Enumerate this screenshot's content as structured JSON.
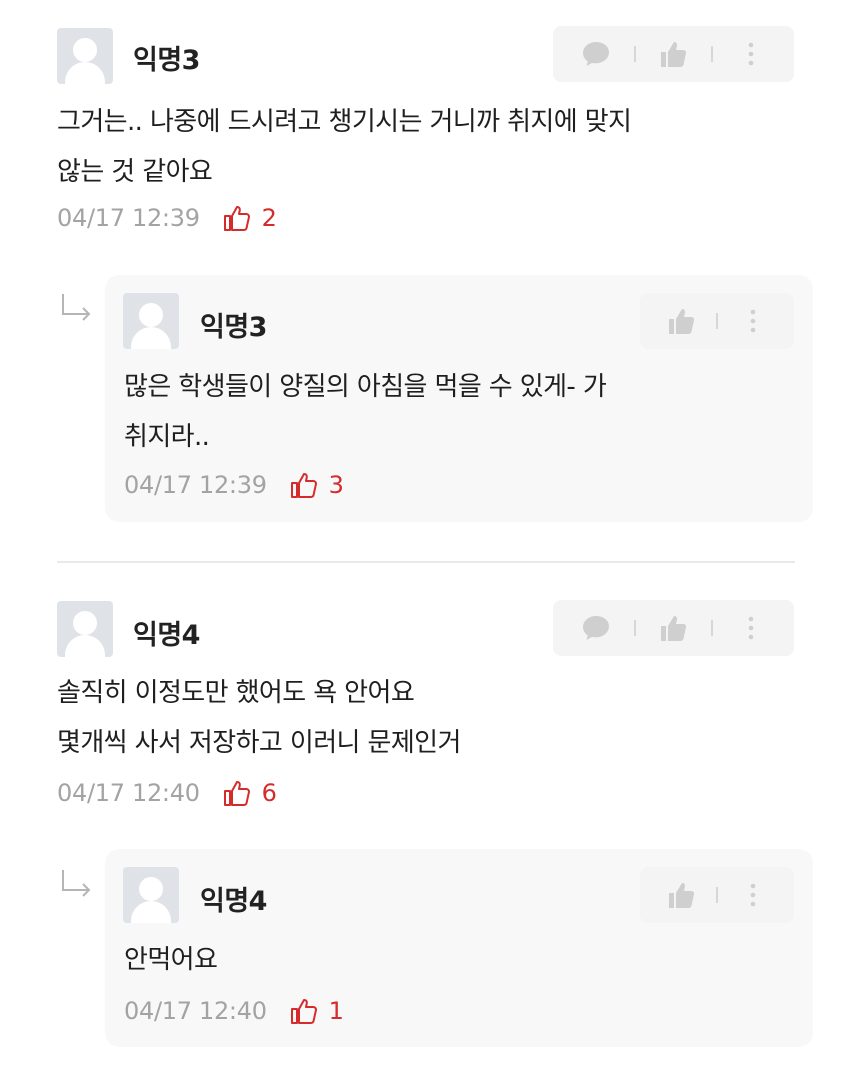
{
  "comments": [
    {
      "nickname": "익명3",
      "text": "그거는.. 나중에 드시려고 챙기시는 거니까 취지에 맞지\n않는 것 같아요",
      "date": "04/17 12:39",
      "likes": "2",
      "reply": {
        "nickname": "익명3",
        "text": "많은 학생들이 양질의 아침을 먹을 수 있게- 가\n취지라..",
        "date": "04/17 12:39",
        "likes": "3"
      }
    },
    {
      "nickname": "익명4",
      "text": "솔직히 이정도만 했어도 욕 안어요\n몇개씩 사서 저장하고 이러니 문제인거",
      "date": "04/17 12:40",
      "likes": "6",
      "reply": {
        "nickname": "익명4",
        "text": "안먹어요",
        "date": "04/17 12:40",
        "likes": "1"
      }
    }
  ],
  "icons": {
    "comment": "speech-bubble-icon",
    "like": "thumbs-up-icon",
    "more": "kebab-menu-icon",
    "reply": "reply-arrow-icon"
  },
  "colors": {
    "like_accent": "#d62b2b",
    "muted_text": "#a3a3a3",
    "action_bg": "#f4f4f4",
    "reply_bg": "#f8f8f8"
  }
}
